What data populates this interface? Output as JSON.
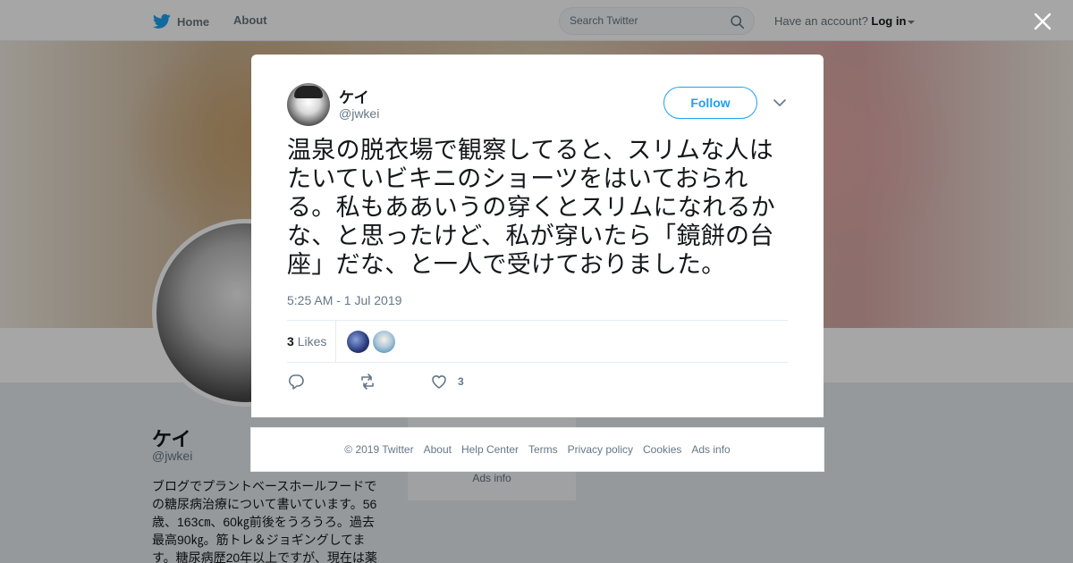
{
  "nav": {
    "home_label": "Home",
    "about_label": "About",
    "search_placeholder": "Search Twitter",
    "have_account_text": "Have an account?",
    "login_label": "Log in"
  },
  "profile": {
    "name": "ケイ",
    "handle": "@jwkei",
    "bio": "ブログでプラントベースホールフードでの糖尿病治療について書いています。56歳、163㎝、60㎏前後をうろうろ。過去最高90㎏。筋トレ＆ジョギングしてます。糖尿病歴20年以上ですが、現在は薬",
    "side_card_ads": "Ads info"
  },
  "tweet": {
    "author_name": "ケイ",
    "author_handle": "@jwkei",
    "follow_label": "Follow",
    "text": "温泉の脱衣場で観察してると、スリムな人はたいていビキニのショーツをはいておられる。私もああいうの穿くとスリムになれるかな、と思ったけど、私が穿いたら「鏡餅の台座」だな、と一人で受けておりました。",
    "timestamp": "5:25 AM - 1 Jul 2019",
    "likes_count": "3",
    "likes_label": "Likes",
    "like_action_count": "3"
  },
  "footer": {
    "copyright": "© 2019 Twitter",
    "links": [
      "About",
      "Help Center",
      "Terms",
      "Privacy policy",
      "Cookies",
      "Ads info"
    ]
  },
  "colors": {
    "brand": "#1da1f2",
    "text": "#14171a",
    "muted": "#657786"
  }
}
